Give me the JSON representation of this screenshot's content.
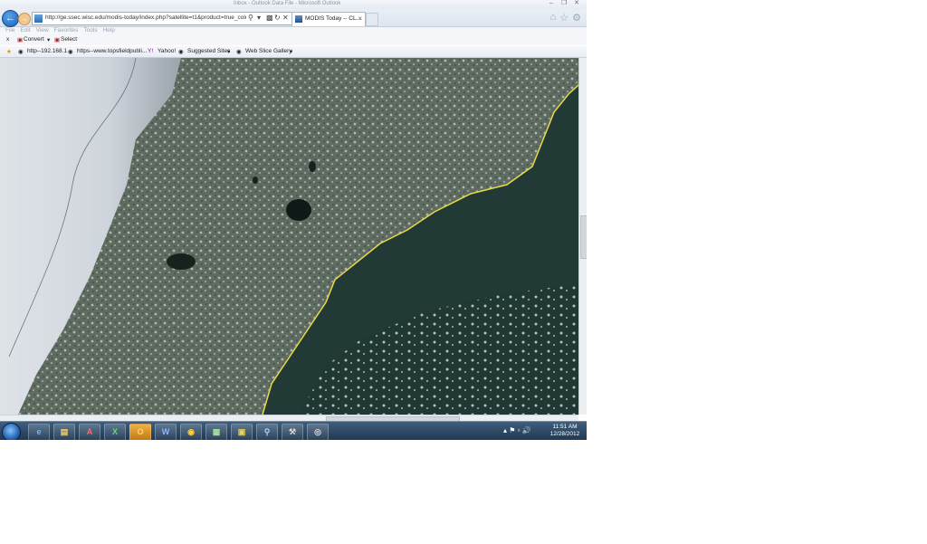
{
  "window": {
    "title": "Inbox - Outlook Data File - Microsoft Outlook"
  },
  "nav": {
    "url": "http://ge.ssec.wisc.edu/modis-today/index.php?satellite=t1&product=true_color&",
    "tab_title": "MODIS Today -- CL..."
  },
  "menu": [
    "File",
    "Edit",
    "View",
    "Favorites",
    "Tools",
    "Help"
  ],
  "commands": {
    "close": "x",
    "convert": "Convert",
    "select": "Select"
  },
  "favorites": {
    "item1": "http--192.168.1",
    "item2": "https--www.topsfieldpubli...",
    "item3": "Yahoo!",
    "item4": "Suggested Sites",
    "item5": "Web Slice Gallery"
  },
  "taskbar": {
    "apps": [
      "internet-explorer",
      "file-explorer",
      "acrobat",
      "excel",
      "outlook",
      "word",
      "chrome",
      "terminal",
      "app-installer",
      "magnifier",
      "tools",
      "media-center"
    ]
  },
  "clock": {
    "time": "11:51 AM",
    "date": "12/28/2012"
  },
  "colors": {
    "ocean": "#223a36",
    "coastline": "#e8d84a",
    "taskbar": "#2b4a6b"
  }
}
